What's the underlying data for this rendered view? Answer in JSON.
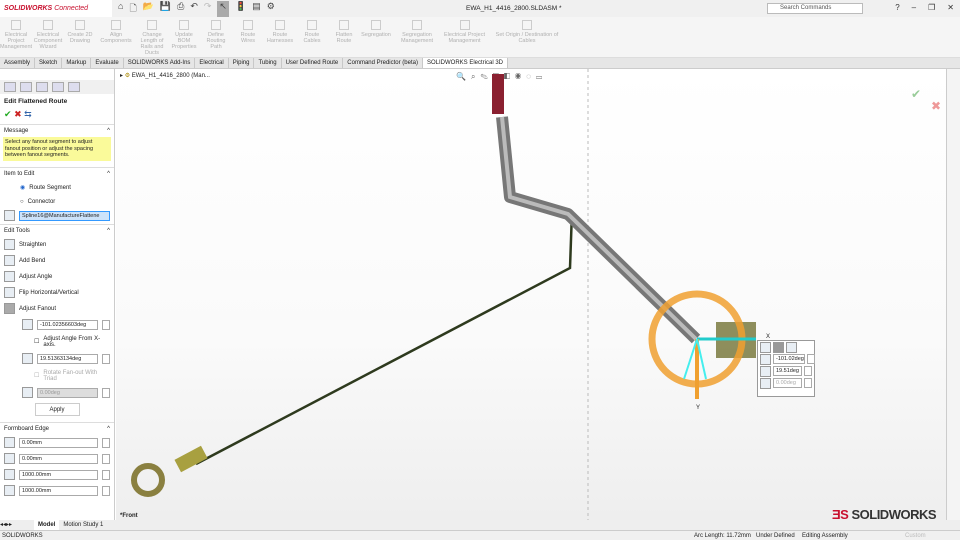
{
  "title": {
    "brand": "SOLIDWORKS",
    "brand_suffix": "Connected",
    "document": "EWA_H1_4416_2800.SLDASM *",
    "search_placeholder": "Search Commands"
  },
  "ribbon": [
    "Electrical Project Management",
    "Electrical Component Wizard",
    "Create 2D Drawing",
    "Align Components",
    "Change Length of Rails and Ducts",
    "Update BOM Properties",
    "Define Routing Path",
    "Route Wires",
    "Route Harnesses",
    "Route Cables",
    "Flatten Route",
    "Segregation",
    "Segregation Management",
    "Electrical Project Management",
    "Set Origin / Destination of Cables"
  ],
  "tabs": [
    "Assembly",
    "Sketch",
    "Markup",
    "Evaluate",
    "SOLIDWORKS Add-Ins",
    "Electrical",
    "Piping",
    "Tubing",
    "User Defined Route",
    "Command Predictor (beta)",
    "SOLIDWORKS Electrical 3D"
  ],
  "tree": {
    "root": "EWA_H1_4416_2800 (Man..."
  },
  "panel": {
    "title": "Edit Flattened Route",
    "message_header": "Message",
    "message": "Select any fanout segment to adjust fanout position or adjust the spacing between fanout segments.",
    "item_header": "Item to Edit",
    "radio_route": "Route Segment",
    "radio_connector": "Connector",
    "route_selected": "Route Segment",
    "selection": "Spline16@ManufactureFlattene",
    "tools_header": "Edit Tools",
    "tools": [
      "Straighten",
      "Add Bend",
      "Adjust Angle",
      "Flip Horizontal/Vertical",
      "Adjust Fanout"
    ],
    "angle": "-101.02356603deg",
    "adjust_from_x": "Adjust Angle From X-axis.",
    "spacing": "19.51363134deg",
    "rotate_fanout": "Rotate Fan-out With Triad",
    "rotate_value": "0.00deg",
    "apply": "Apply",
    "formboard_header": "Formboard Edge",
    "formboard": [
      "0.00mm",
      "0.00mm",
      "1000.00mm",
      "1000.00mm"
    ]
  },
  "popup": {
    "angle": "-101.02deg",
    "spacing": "19.51deg",
    "rotate": "0.00deg"
  },
  "viewport": {
    "view_label": "*Front",
    "axis_x": "X",
    "axis_y": "Y",
    "watermark": "SOLIDWORKS"
  },
  "bottom_tabs": [
    "Model",
    "Motion Study 1"
  ],
  "status": {
    "app": "SOLIDWORKS",
    "arc_length": "Arc Length: 11.72mm",
    "defined": "Under Defined",
    "mode": "Editing Assembly",
    "units": "Custom"
  },
  "colors": {
    "accent": "#c8102e",
    "triad": "#f0a030",
    "highlight": "#fafa9a",
    "route": "#2e3a1e"
  }
}
